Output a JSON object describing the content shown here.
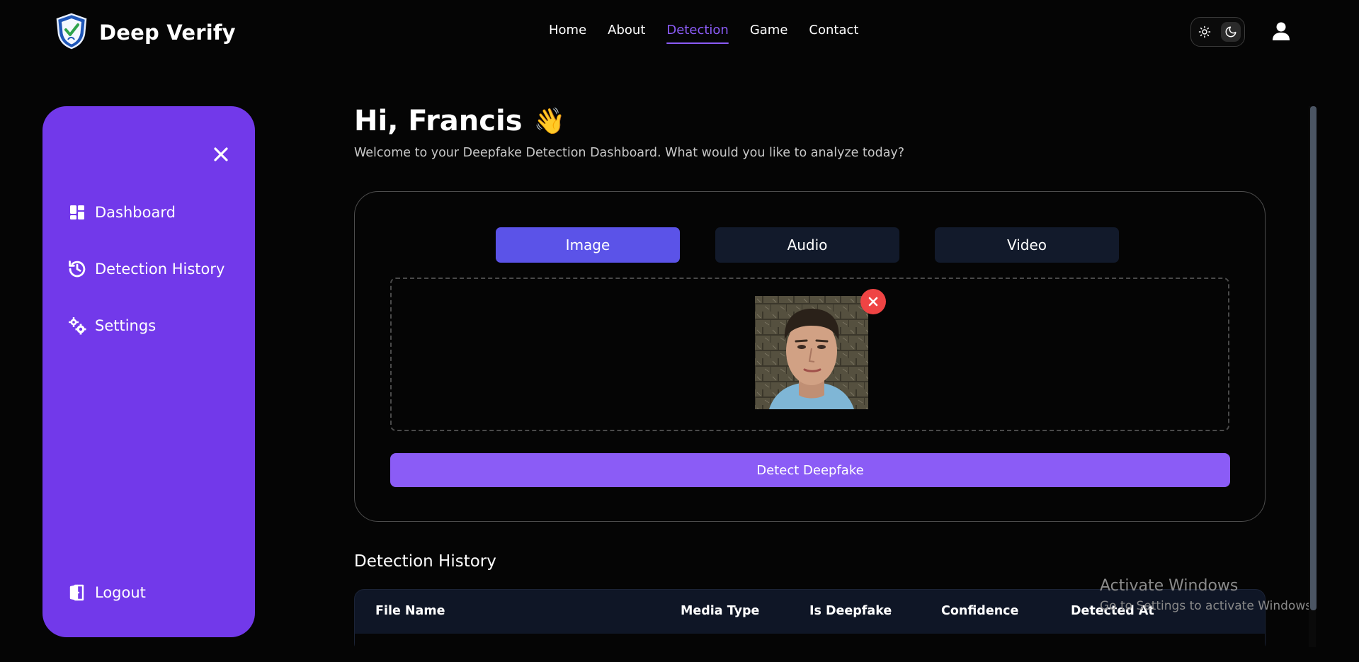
{
  "header": {
    "brand_title": "Deep Verify",
    "logo_icon": "shield-logo-icon",
    "nav": [
      {
        "label": "Home",
        "active": false
      },
      {
        "label": "About",
        "active": false
      },
      {
        "label": "Detection",
        "active": true
      },
      {
        "label": "Game",
        "active": false
      },
      {
        "label": "Contact",
        "active": false
      }
    ],
    "theme": {
      "light_icon": "sun-icon",
      "dark_icon": "moon-icon",
      "selected": "dark"
    },
    "user_icon": "user-icon"
  },
  "sidebar": {
    "close_icon": "close-icon",
    "items": [
      {
        "label": "Dashboard",
        "icon": "dashboard-icon"
      },
      {
        "label": "Detection History",
        "icon": "history-icon"
      },
      {
        "label": "Settings",
        "icon": "gears-icon"
      }
    ],
    "logout_label": "Logout"
  },
  "main": {
    "greeting": "Hi, Francis",
    "wave_emoji": "👋",
    "subtitle": "Welcome to your Deepfake Detection Dashboard. What would you like to analyze today?",
    "tabs": [
      {
        "label": "Image",
        "active": true
      },
      {
        "label": "Audio",
        "active": false
      },
      {
        "label": "Video",
        "active": false
      }
    ],
    "detect_button": "Detect Deepfake",
    "history_title": "Detection History",
    "table_headers": [
      "File Name",
      "Media Type",
      "Is Deepfake",
      "Confidence",
      "Detected At"
    ]
  },
  "system": {
    "watermark_line1": "Activate Windows",
    "watermark_line2": "Go to Settings to activate Windows."
  },
  "colors": {
    "accent": "#8b5cf6",
    "sidebar": "#7239ea",
    "active_tab": "#5b53e8",
    "remove": "#ef4444"
  }
}
